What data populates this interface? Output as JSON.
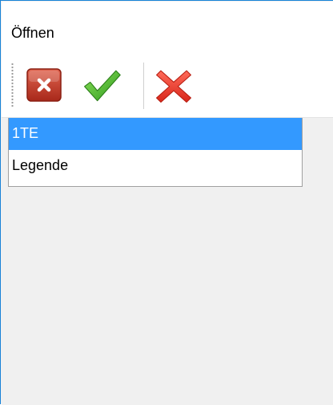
{
  "window": {
    "title": "Öffnen"
  },
  "toolbar": {
    "buttons": [
      {
        "icon": "close-box-icon"
      },
      {
        "icon": "checkmark-icon"
      },
      {
        "icon": "red-x-icon"
      }
    ]
  },
  "list": {
    "items": [
      {
        "label": "1TE",
        "selected": true
      },
      {
        "label": "Legende",
        "selected": false
      }
    ]
  },
  "colors": {
    "selection": "#3399ff",
    "window_border": "#1883d7"
  }
}
